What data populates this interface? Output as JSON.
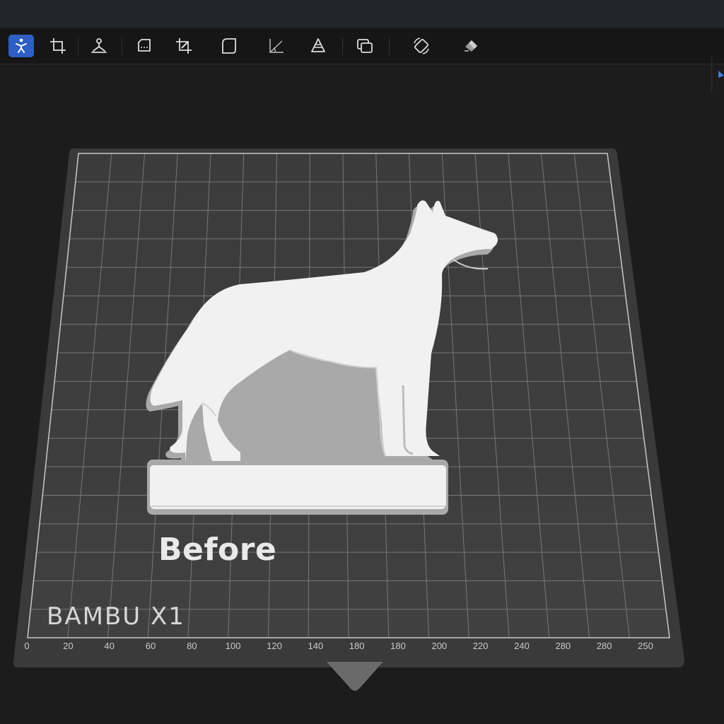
{
  "toolbar": {
    "tools": [
      {
        "name": "move-icon",
        "active": true
      },
      {
        "name": "crop-icon",
        "active": false
      },
      {
        "name": "split-icon",
        "active": false
      },
      {
        "name": "cut-plane-icon",
        "active": false
      },
      {
        "name": "crop-pencil-icon",
        "active": false
      },
      {
        "name": "rounded-square-icon",
        "active": false
      },
      {
        "name": "angle-icon",
        "active": false
      },
      {
        "name": "layer-height-icon",
        "active": false
      },
      {
        "name": "duplicate-icon",
        "active": false
      },
      {
        "name": "rotate-icon",
        "active": false
      },
      {
        "name": "paint-icon",
        "active": false
      }
    ],
    "accent": "#2f5fc4"
  },
  "plate": {
    "brand": "BAMBU X1",
    "ruler": [
      "0",
      "20",
      "40",
      "60",
      "80",
      "100",
      "120",
      "140",
      "180",
      "180",
      "200",
      "220",
      "240",
      "280",
      "280",
      "250"
    ]
  },
  "model": {
    "caption": "Before",
    "color": "#f1f1f1"
  }
}
